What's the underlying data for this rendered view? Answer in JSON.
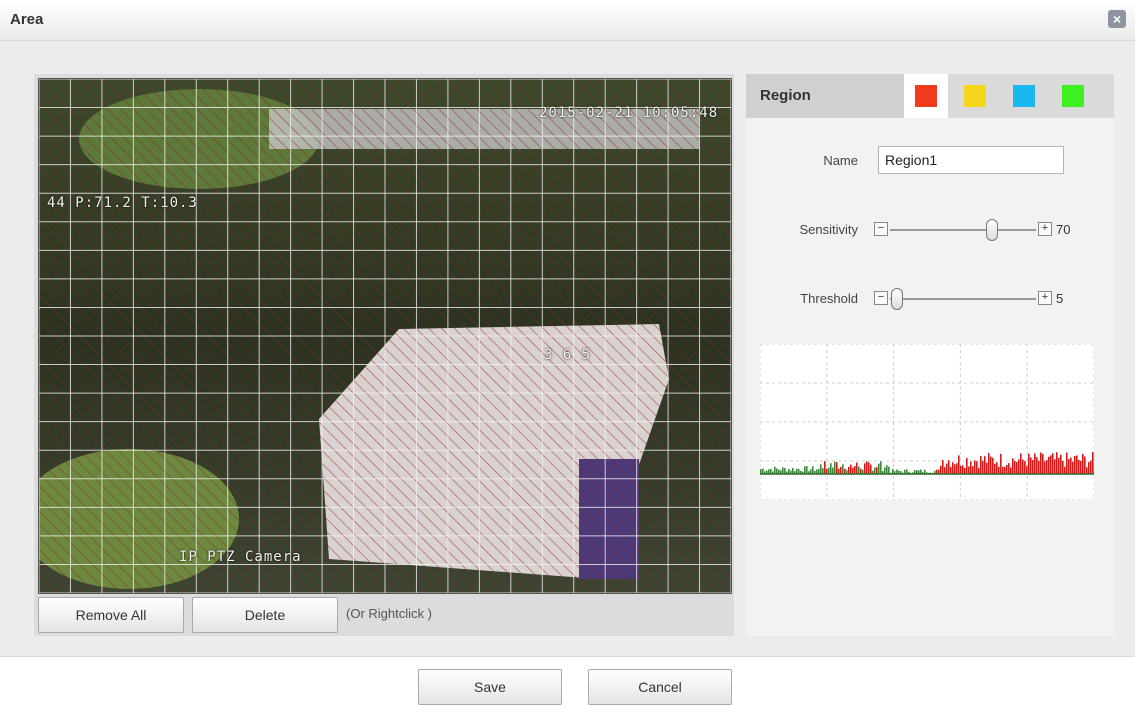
{
  "window": {
    "title": "Area",
    "close_icon": "×"
  },
  "video": {
    "osd_time": "2015-02-21 10:05:48",
    "osd_ptz": "44 P:71.2 T:10.3",
    "osd_camera": "IP PTZ Camera",
    "osd_number": "3 6 5",
    "grid_color": "#8b1a1a"
  },
  "actions": {
    "remove_all": "Remove All",
    "delete": "Delete",
    "hint": "(Or Rightclick )"
  },
  "region": {
    "header_label": "Region",
    "colors": [
      {
        "name": "red",
        "hex": "#f03b1f",
        "selected": true
      },
      {
        "name": "yellow",
        "hex": "#f7d61a",
        "selected": false
      },
      {
        "name": "cyan",
        "hex": "#1ab6f0",
        "selected": false
      },
      {
        "name": "green",
        "hex": "#3df11f",
        "selected": false
      }
    ],
    "name_label": "Name",
    "name_value": "Region1",
    "sensitivity_label": "Sensitivity",
    "sensitivity_value": "70",
    "sensitivity_level": 0.7,
    "threshold_label": "Threshold",
    "threshold_value": "5",
    "threshold_level": 0.05,
    "minus_symbol": "−",
    "plus_symbol": "+"
  },
  "footer": {
    "save": "Save",
    "cancel": "Cancel"
  }
}
